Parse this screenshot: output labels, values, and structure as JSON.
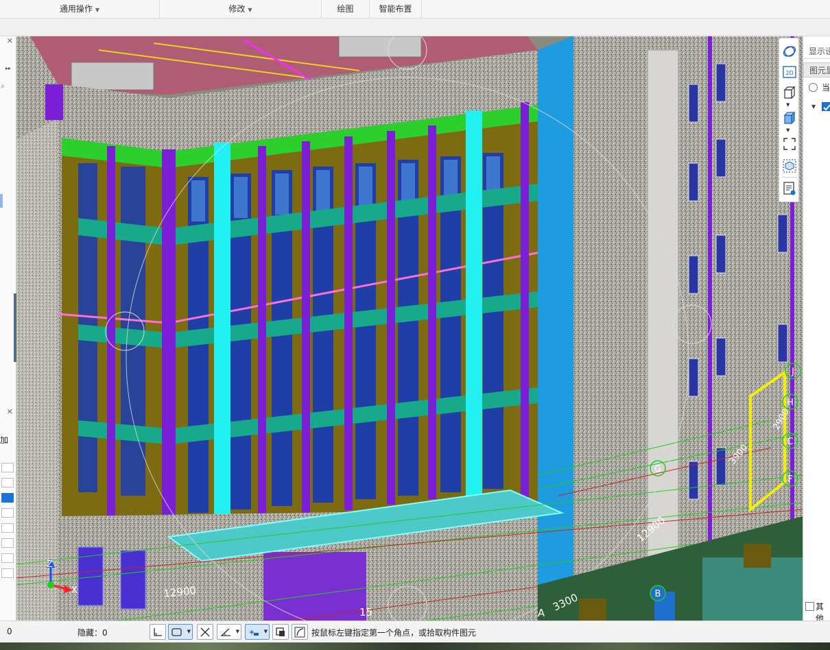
{
  "ribbon": {
    "groups": [
      {
        "label": "通用操作",
        "has_dropdown": true
      },
      {
        "label": "修改",
        "has_dropdown": true
      },
      {
        "label": "绘图",
        "has_dropdown": false
      },
      {
        "label": "智能布置",
        "has_dropdown": false
      }
    ]
  },
  "left_panel": {
    "collapse_glyph": "▸▸",
    "partial_label": "加"
  },
  "viewport": {
    "axis_labels": {
      "z": "Z",
      "x": "X"
    },
    "grid_bubbles": [
      "A",
      "B",
      "G",
      "H",
      "C",
      "F",
      "J"
    ],
    "dimensions": [
      "12900",
      "3300",
      "12900",
      "15",
      "3900",
      "2900"
    ],
    "colors": {
      "wall": "#a9a79e",
      "column_purple": "#7a1fd6",
      "column_cyan": "#23f0f0",
      "beam_green": "#2ccf2c",
      "window_blue": "#1f3fa6",
      "glass": "#4f8fe0",
      "infill_olive": "#7d6b12",
      "teal_band": "#17a98a",
      "roof": "#b05c74",
      "slab_cyan": "#4ec9c9"
    }
  },
  "nav_tools": [
    {
      "name": "dynamic-observe-icon"
    },
    {
      "name": "2d-view-icon",
      "label": "2D"
    },
    {
      "name": "3d-view-icon"
    },
    {
      "name": "3d-solid-view-icon"
    },
    {
      "name": "fullscreen-icon"
    },
    {
      "name": "box-select-icon"
    },
    {
      "name": "display-settings-icon"
    }
  ],
  "right_panel": {
    "tab1": "显示设置",
    "tab2": "图元显示",
    "radio_label": "当",
    "checkbox_bottom": "其他"
  },
  "status_bar": {
    "left_value": "0",
    "hidden_label": "隐藏：0",
    "prompt": "按鼠标左键指定第一个角点，或拾取构件图元"
  }
}
